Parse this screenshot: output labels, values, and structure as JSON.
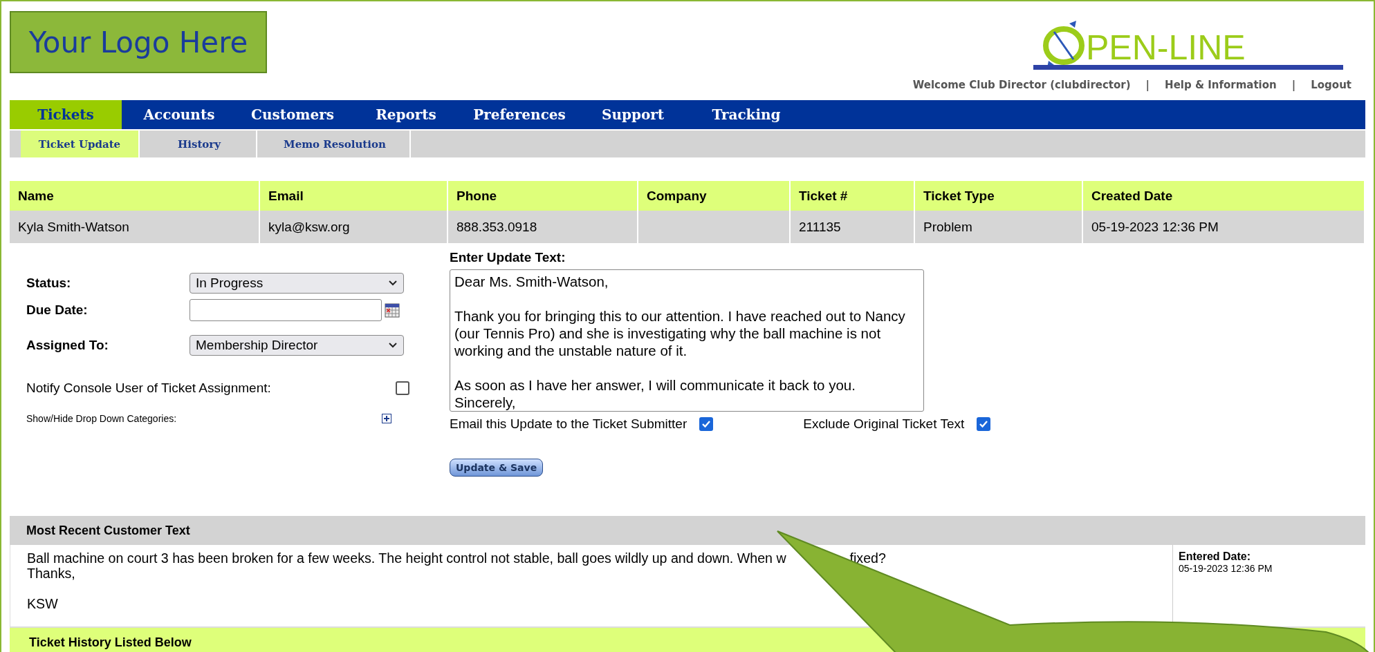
{
  "logo": {
    "text": "Your Logo Here"
  },
  "brand": {
    "text": "PEN-LINE"
  },
  "user_links": [
    {
      "label": "Welcome Club Director (clubdirector)"
    },
    {
      "label": "Help & Information"
    },
    {
      "label": "Logout"
    }
  ],
  "link_separator": "|",
  "main_tabs": [
    {
      "label": "Tickets",
      "selected": true
    },
    {
      "label": "Accounts",
      "selected": false
    },
    {
      "label": "Customers",
      "selected": false
    },
    {
      "label": "Reports",
      "selected": false
    },
    {
      "label": "Preferences",
      "selected": false
    },
    {
      "label": "Support",
      "selected": false
    },
    {
      "label": "Tracking",
      "selected": false
    }
  ],
  "sub_tabs": [
    {
      "label": "Ticket Update",
      "selected": true
    },
    {
      "label": "History",
      "selected": false
    },
    {
      "label": "Memo Resolution",
      "selected": false
    }
  ],
  "ticket_table": {
    "columns": [
      "Name",
      "Email",
      "Phone",
      "Company",
      "Ticket #",
      "Ticket Type",
      "Created Date"
    ],
    "rows": [
      [
        "Kyla Smith-Watson",
        "kyla@ksw.org",
        "888.353.0918",
        "",
        "211135",
        "Problem",
        "05-19-2023 12:36 PM"
      ]
    ]
  },
  "form": {
    "status": {
      "label": "Status:",
      "value": "In Progress"
    },
    "due_date": {
      "label": "Due Date:"
    },
    "assigned_to": {
      "label": "Assigned To:",
      "value": "Membership Director"
    },
    "notify": {
      "label": "Notify Console User of Ticket Assignment:",
      "checked": false
    },
    "categories": {
      "label": "Show/Hide Drop Down Categories:",
      "expanded": false
    }
  },
  "update": {
    "label": "Enter Update Text:",
    "value": "Dear Ms. Smith-Watson,\n\nThank you for bringing this to our attention. I have reached out to Nancy (our Tennis Pro) and she is investigating why the ball machine is not working and the unstable nature of it.\n\nAs soon as I have her answer, I will communicate it back to you.\nSincerely,",
    "options": [
      {
        "label": "Email this Update to the Ticket Submitter",
        "checked": true
      },
      {
        "label": "Exclude Original Ticket Text",
        "checked": true
      }
    ],
    "button": "Update & Save"
  },
  "recent": {
    "title": "Most Recent Customer Text",
    "text_before_callout": "Ball machine on court 3 has been broken for a few weeks. The height control not stable, ball goes wildly up and down. When w",
    "text_after_callout": "fixed?",
    "closing": "Thanks,",
    "signature": "KSW",
    "date_label": "Entered Date:",
    "date": "05-19-2023 12:36 PM"
  },
  "history": {
    "title": "Ticket History Listed Below"
  }
}
